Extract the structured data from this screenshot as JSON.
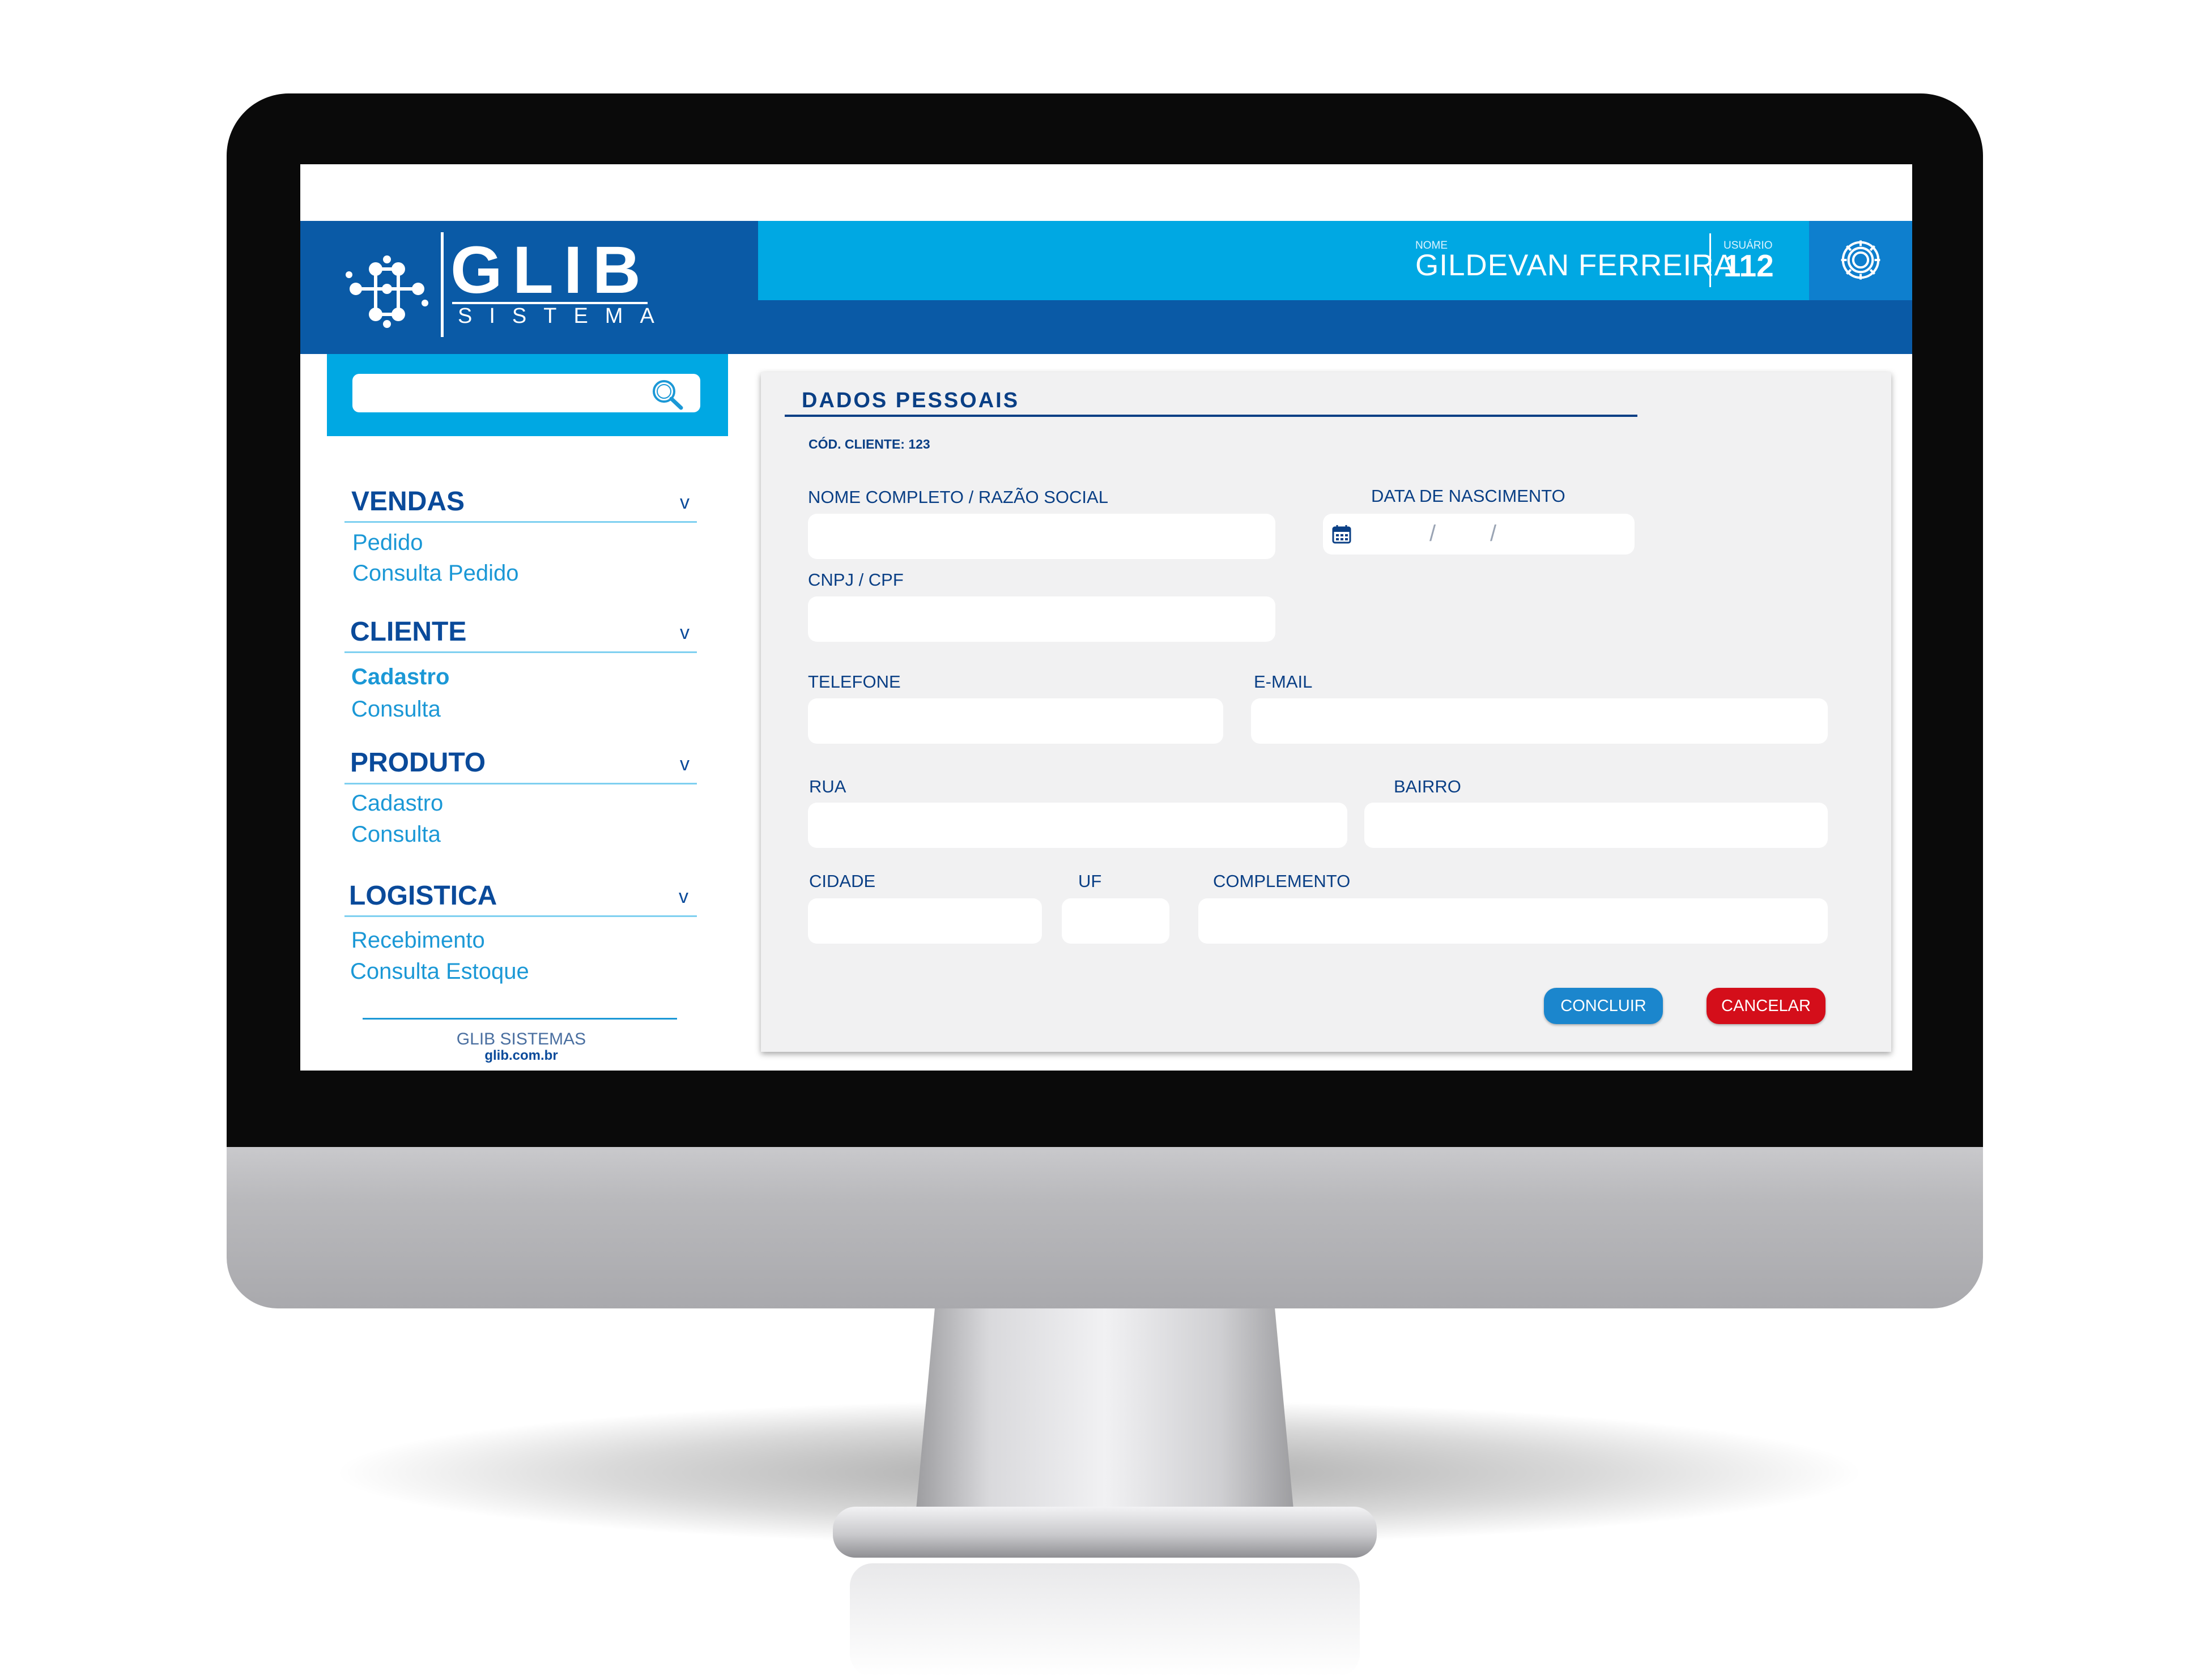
{
  "header": {
    "logo_text": "GLIB",
    "logo_sub": "SISTEMA",
    "nome_label": "NOME",
    "nome_value": "GILDEVAN FERREIRA",
    "usuario_label": "USUÁRIO",
    "usuario_value": "112",
    "gear_icon": "gear-icon"
  },
  "sidebar": {
    "search": {
      "placeholder": "",
      "value": "",
      "icon": "search-icon"
    },
    "sections": [
      {
        "title": "VENDAS",
        "items": [
          {
            "label": "Pedido"
          },
          {
            "label": "Consulta Pedido"
          }
        ]
      },
      {
        "title": "CLIENTE",
        "items": [
          {
            "label": "Cadastro",
            "active": true
          },
          {
            "label": "Consulta"
          }
        ]
      },
      {
        "title": "PRODUTO",
        "items": [
          {
            "label": "Cadastro"
          },
          {
            "label": "Consulta"
          }
        ]
      },
      {
        "title": "LOGISTICA",
        "items": [
          {
            "label": "Recebimento"
          },
          {
            "label": "Consulta Estoque"
          }
        ]
      }
    ],
    "chevron": "v",
    "footer": {
      "company": "GLIB SISTEMAS",
      "site": "glib.com.br"
    }
  },
  "form": {
    "title": "DADOS PESSOAIS",
    "cod_cliente": "CÓD. CLIENTE: 123",
    "labels": {
      "nome": "NOME COMPLETO / RAZÃO SOCIAL",
      "nascimento": "DATA DE NASCIMENTO",
      "cnpj": "CNPJ / CPF",
      "telefone": "TELEFONE",
      "email": "E-MAIL",
      "rua": "RUA",
      "bairro": "BAIRRO",
      "cidade": "CIDADE",
      "uf": "UF",
      "complemento": "COMPLEMENTO"
    },
    "values": {
      "nome": "",
      "cnpj": "",
      "telefone": "",
      "email": "",
      "rua": "",
      "bairro": "",
      "cidade": "",
      "uf": "",
      "complemento": ""
    },
    "date_separator": "/",
    "calendar_icon": "calendar-icon",
    "buttons": {
      "concluir": "CONCLUIR",
      "cancelar": "CANCELAR"
    }
  },
  "colors": {
    "primary_dark": "#0a5aa6",
    "primary_light": "#00a8e3",
    "text_dark": "#0a3f85",
    "link": "#1b98d6",
    "confirm": "#1b86cd",
    "cancel": "#d40e1a",
    "panel_bg": "#f1f1f2"
  }
}
